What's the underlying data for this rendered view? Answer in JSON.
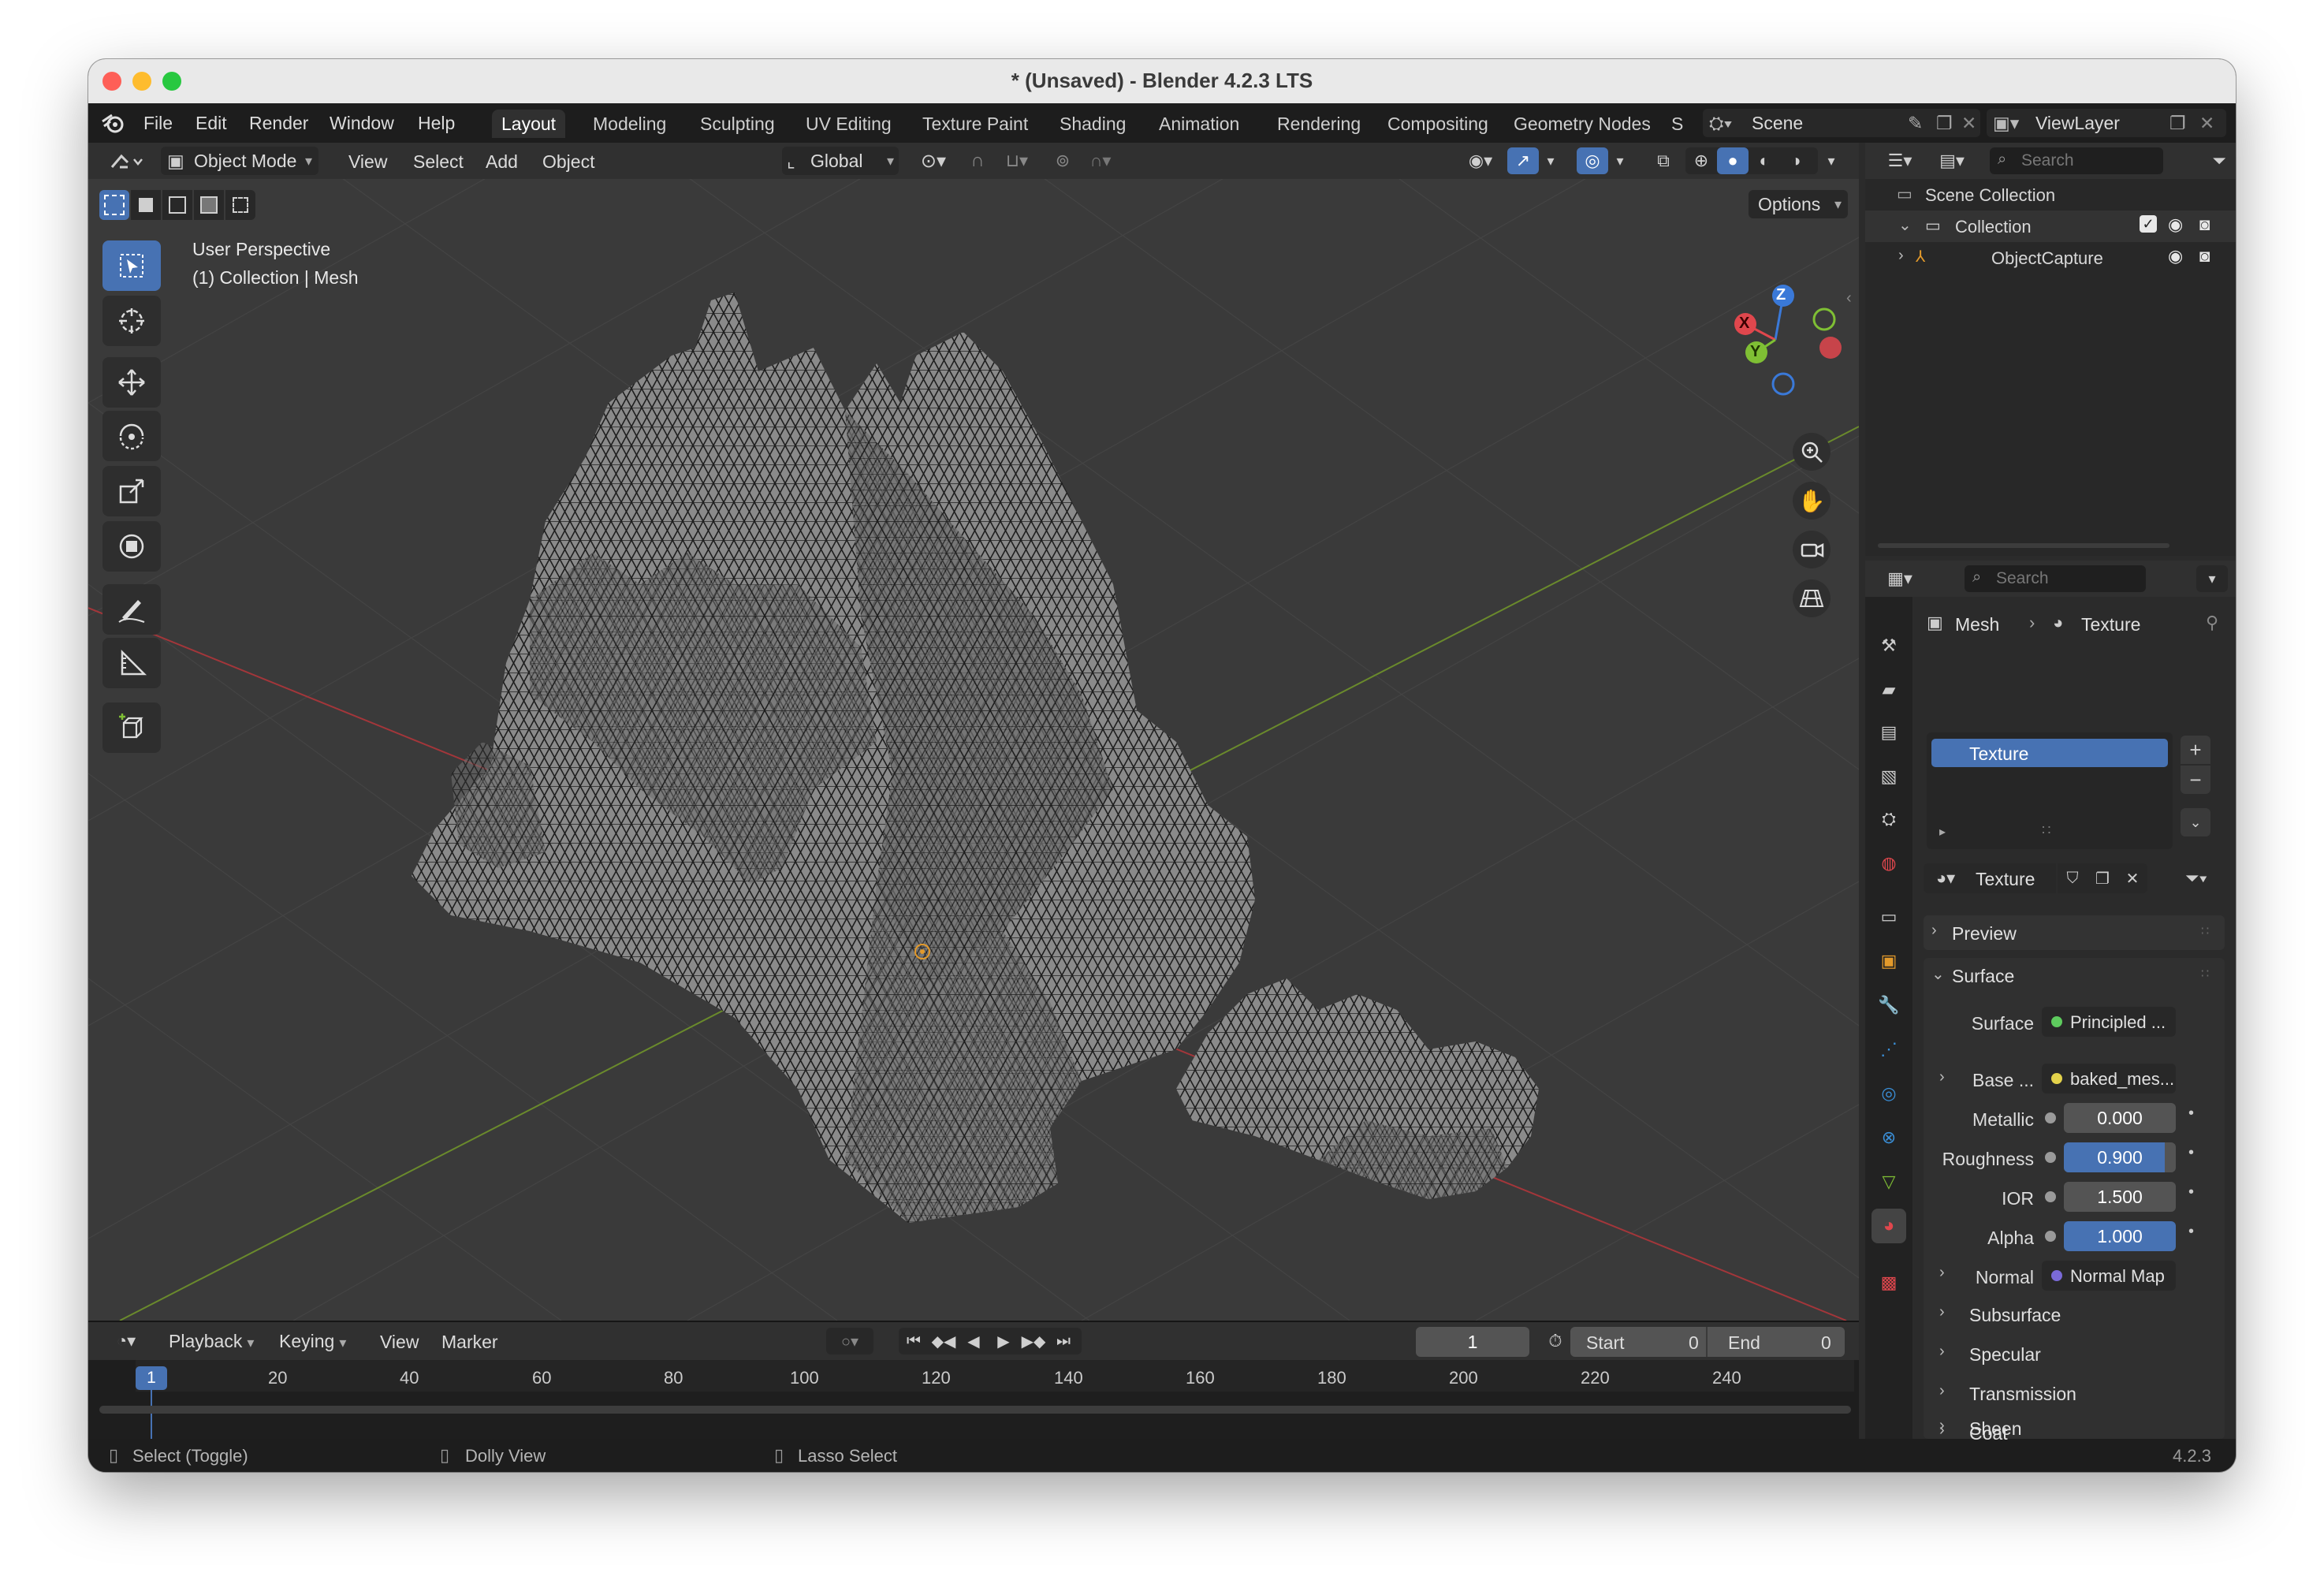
{
  "window": {
    "title": "* (Unsaved) - Blender 4.2.3 LTS"
  },
  "menu": {
    "items": [
      "File",
      "Edit",
      "Render",
      "Window",
      "Help"
    ]
  },
  "workspaces": [
    "Layout",
    "Modeling",
    "Sculpting",
    "UV Editing",
    "Texture Paint",
    "Shading",
    "Animation",
    "Rendering",
    "Compositing",
    "Geometry Nodes",
    "S"
  ],
  "topright": {
    "scene": "Scene",
    "viewlayer": "ViewLayer"
  },
  "viewport_header": {
    "mode": "Object Mode",
    "menus": [
      "View",
      "Select",
      "Add",
      "Object"
    ],
    "orientation": "Global",
    "options": "Options"
  },
  "viewport": {
    "perspective": "User Perspective",
    "collection": "(1) Collection | Mesh"
  },
  "gizmo": {
    "z": "Z",
    "y": "Y",
    "x": "X"
  },
  "outliner": {
    "search": "Search",
    "items": [
      "Scene Collection",
      "Collection",
      "ObjectCapture"
    ]
  },
  "properties": {
    "search": "Search",
    "breadcrumb": {
      "object": "Mesh",
      "material": "Texture"
    },
    "slot": "Texture",
    "material_name": "Texture",
    "sections": {
      "preview": "Preview",
      "surface": "Surface"
    },
    "surface_row": {
      "label": "Surface",
      "value": "Principled ..."
    },
    "base_row": {
      "label": "Base ...",
      "value": "baked_mes..."
    },
    "metallic": {
      "label": "Metallic",
      "value": "0.000"
    },
    "roughness": {
      "label": "Roughness",
      "value": "0.900",
      "fraction": 0.9
    },
    "ior": {
      "label": "IOR",
      "value": "1.500"
    },
    "alpha": {
      "label": "Alpha",
      "value": "1.000",
      "fraction": 1.0
    },
    "normal": {
      "label": "Normal",
      "value": "Normal Map"
    },
    "subsections": [
      "Subsurface",
      "Specular",
      "Transmission",
      "Coat",
      "Sheen"
    ]
  },
  "timeline": {
    "menus": [
      "Playback",
      "Keying",
      "View",
      "Marker"
    ],
    "current_frame": "1",
    "start_label": "Start",
    "start_value": "0",
    "end_label": "End",
    "end_value": "0",
    "ruler": [
      "20",
      "40",
      "60",
      "80",
      "100",
      "120",
      "140",
      "160",
      "180",
      "200",
      "220",
      "240"
    ],
    "cursor": "1"
  },
  "statusbar": {
    "items": [
      "Select (Toggle)",
      "Dolly View",
      "Lasso Select"
    ],
    "version": "4.2.3"
  },
  "colors": {
    "accent": "#4772b3",
    "x_axis": "#e0474d",
    "y_axis": "#7fbf34",
    "z_axis": "#3a79d8"
  }
}
